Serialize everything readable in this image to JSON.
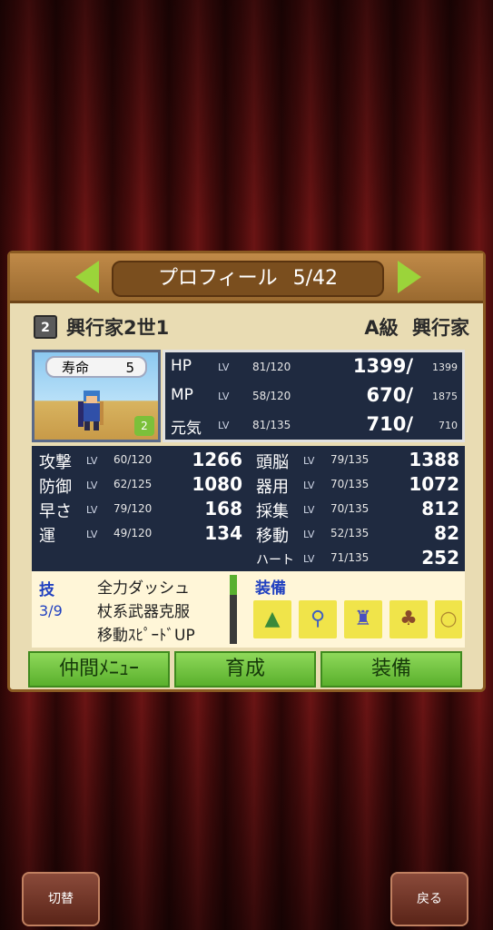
{
  "header": {
    "title": "プロフィール",
    "page": "5/42"
  },
  "character": {
    "generation_badge": "2",
    "name": "興行家2世1",
    "rank": "A級",
    "job": "興行家",
    "lifespan_label": "寿命",
    "lifespan_value": "5",
    "sub_badge": "2"
  },
  "vitals": [
    {
      "label": "HP",
      "lv_label": "LV",
      "lv": "81/120",
      "current": "1399/",
      "max": "1399"
    },
    {
      "label": "MP",
      "lv_label": "LV",
      "lv": "58/120",
      "current": "670/",
      "max": "1875"
    },
    {
      "label": "元気",
      "lv_label": "LV",
      "lv": "81/135",
      "current": "710/",
      "max": "710"
    }
  ],
  "stats_left": [
    {
      "label": "攻撃",
      "lv_label": "LV",
      "lv": "60/120",
      "value": "1266"
    },
    {
      "label": "防御",
      "lv_label": "LV",
      "lv": "62/125",
      "value": "1080"
    },
    {
      "label": "早さ",
      "lv_label": "LV",
      "lv": "79/120",
      "value": "168"
    },
    {
      "label": "運",
      "lv_label": "LV",
      "lv": "49/120",
      "value": "134"
    }
  ],
  "stats_right": [
    {
      "label": "頭脳",
      "lv_label": "LV",
      "lv": "79/135",
      "value": "1388"
    },
    {
      "label": "器用",
      "lv_label": "LV",
      "lv": "70/135",
      "value": "1072"
    },
    {
      "label": "採集",
      "lv_label": "LV",
      "lv": "70/135",
      "value": "812"
    },
    {
      "label": "移動",
      "lv_label": "LV",
      "lv": "52/135",
      "value": "82"
    },
    {
      "label": "ハート",
      "lv_label": "LV",
      "lv": "71/135",
      "value": "252"
    }
  ],
  "skills": {
    "label": "技",
    "count": "3/9",
    "items": [
      "全力ダッシュ",
      "杖系武器克服",
      "移動ｽﾋﾟｰﾄﾞUP"
    ]
  },
  "equipment": {
    "label": "装備",
    "slots": [
      {
        "icon": "green-hat-icon",
        "glyph": "▲",
        "color": "#3a8a3a"
      },
      {
        "icon": "staff-icon",
        "glyph": "⚲",
        "color": "#4060c0"
      },
      {
        "icon": "armor-icon",
        "glyph": "♜",
        "color": "#4a50c0"
      },
      {
        "icon": "leather-vest-icon",
        "glyph": "♣",
        "color": "#8a4a2a"
      },
      {
        "icon": "ring-icon",
        "glyph": "○",
        "color": "#b08a30"
      }
    ]
  },
  "buttons": {
    "party_menu": "仲間ﾒﾆｭｰ",
    "train": "育成",
    "equip": "装備"
  },
  "footer": {
    "switch": "切替",
    "back": "戻る"
  }
}
